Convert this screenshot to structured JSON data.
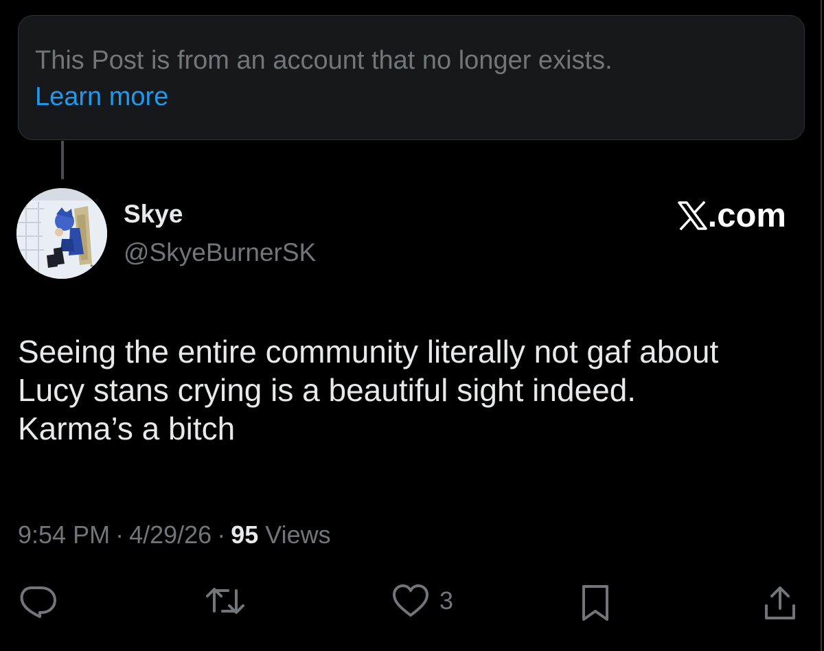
{
  "deleted_notice": {
    "text": "This Post is from an account that no longer exists.",
    "link": "Learn more"
  },
  "post": {
    "author": {
      "display_name": "Skye",
      "handle": "@SkyeBurnerSK",
      "avatar_icon": "avatar-anime-character"
    },
    "brand": {
      "icon": "x-logo-icon",
      "text": ".com"
    },
    "text": "Seeing the entire community literally not gaf about\nLucy stans crying is a beautiful sight indeed.\nKarma’s a bitch",
    "meta": {
      "time": "9:54 PM",
      "separator": "·",
      "date": "4/29/26",
      "views_count": "95",
      "views_label": "Views"
    },
    "actions": {
      "reply_icon": "reply-icon",
      "repost_icon": "repost-icon",
      "like_icon": "heart-icon",
      "like_count": "3",
      "bookmark_icon": "bookmark-icon",
      "share_icon": "share-icon"
    }
  },
  "colors": {
    "background": "#000000",
    "card": "#16181c",
    "muted": "#71767b",
    "text": "#e7e9ea",
    "link": "#1d9bf0"
  }
}
